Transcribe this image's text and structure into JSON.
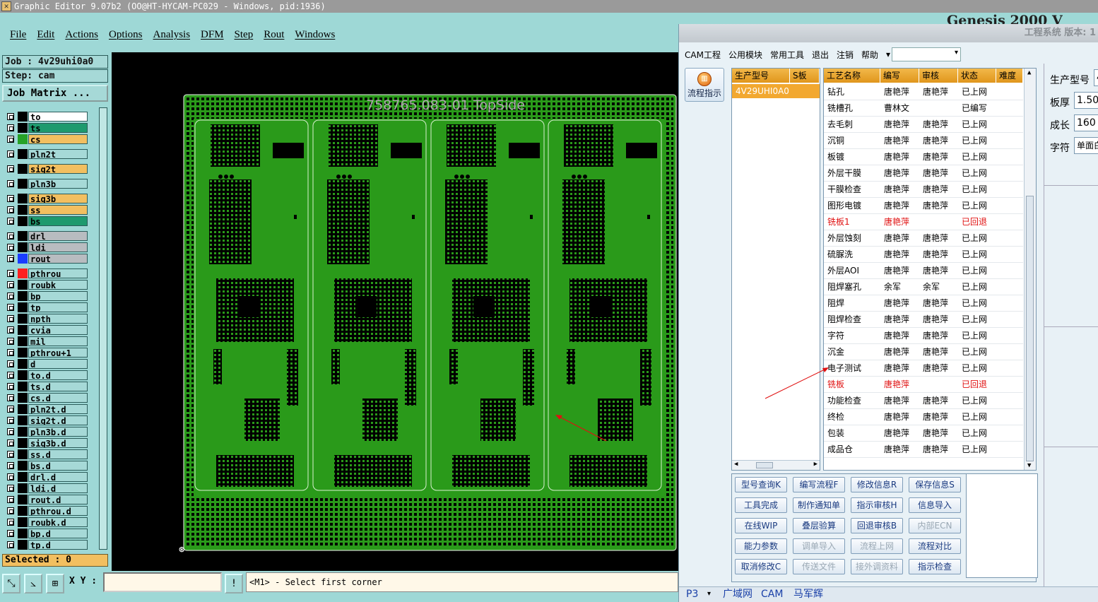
{
  "window_title": "Graphic Editor 9.07b2 (OO@HT-HYCAM-PC029 - Windows, pid:1936)",
  "bg_window_title": "Genesis 2000 V",
  "menu": [
    "File",
    "Edit",
    "Actions",
    "Options",
    "Analysis",
    "DFM",
    "Step",
    "Rout",
    "Windows"
  ],
  "job_label": "Job : 4v29uhi0a0",
  "step_label": "Step: cam",
  "job_matrix_button": "Job Matrix ...",
  "layers": [
    {
      "name": "to",
      "color": "#ffffff",
      "swatch": "#000000"
    },
    {
      "name": "ts",
      "color": "#1e9a6e",
      "swatch": "#000000"
    },
    {
      "name": "cs",
      "color": "#f2bf60",
      "swatch": "#27a227"
    },
    {
      "name": "pln2t",
      "color": "#a6d9d7",
      "swatch": "#000000"
    },
    {
      "name": "sig2t",
      "color": "#f2bf60",
      "swatch": "#000000"
    },
    {
      "name": "pln3b",
      "color": "#a6d9d7",
      "swatch": "#000000"
    },
    {
      "name": "sig3b",
      "color": "#f2bf60",
      "swatch": "#000000"
    },
    {
      "name": "ss",
      "color": "#f2bf60",
      "swatch": "#000000"
    },
    {
      "name": "bs",
      "color": "#1e9a6e",
      "swatch": "#000000"
    },
    {
      "name": "drl",
      "color": "#b8bcc0",
      "swatch": "#000000"
    },
    {
      "name": "ldi",
      "color": "#b8bcc0",
      "swatch": "#000000"
    },
    {
      "name": "rout",
      "color": "#b8bcc0",
      "swatch": "#1a3cff"
    },
    {
      "name": "pthrou",
      "color": "#a6d9d7",
      "swatch": "#ff2020"
    },
    {
      "name": "roubk",
      "color": "#a6d9d7",
      "swatch": "#000000"
    },
    {
      "name": "bp",
      "color": "#a6d9d7",
      "swatch": "#000000"
    },
    {
      "name": "tp",
      "color": "#a6d9d7",
      "swatch": "#000000"
    },
    {
      "name": "npth",
      "color": "#a6d9d7",
      "swatch": "#000000"
    },
    {
      "name": "cvia",
      "color": "#a6d9d7",
      "swatch": "#000000"
    },
    {
      "name": "mil",
      "color": "#a6d9d7",
      "swatch": "#000000"
    },
    {
      "name": "pthrou+1",
      "color": "#a6d9d7",
      "swatch": "#000000"
    },
    {
      "name": "d",
      "color": "#a6d9d7",
      "swatch": "#000000"
    },
    {
      "name": "to.d",
      "color": "#a6d9d7",
      "swatch": "#000000"
    },
    {
      "name": "ts.d",
      "color": "#a6d9d7",
      "swatch": "#000000"
    },
    {
      "name": "cs.d",
      "color": "#a6d9d7",
      "swatch": "#000000"
    },
    {
      "name": "pln2t.d",
      "color": "#a6d9d7",
      "swatch": "#000000"
    },
    {
      "name": "sig2t.d",
      "color": "#a6d9d7",
      "swatch": "#000000"
    },
    {
      "name": "pln3b.d",
      "color": "#a6d9d7",
      "swatch": "#000000"
    },
    {
      "name": "sig3b.d",
      "color": "#a6d9d7",
      "swatch": "#000000"
    },
    {
      "name": "ss.d",
      "color": "#a6d9d7",
      "swatch": "#000000"
    },
    {
      "name": "bs.d",
      "color": "#a6d9d7",
      "swatch": "#000000"
    },
    {
      "name": "drl.d",
      "color": "#a6d9d7",
      "swatch": "#000000"
    },
    {
      "name": "ldi.d",
      "color": "#a6d9d7",
      "swatch": "#000000"
    },
    {
      "name": "rout.d",
      "color": "#a6d9d7",
      "swatch": "#000000"
    },
    {
      "name": "pthrou.d",
      "color": "#a6d9d7",
      "swatch": "#000000"
    },
    {
      "name": "roubk.d",
      "color": "#a6d9d7",
      "swatch": "#000000"
    },
    {
      "name": "bp.d",
      "color": "#a6d9d7",
      "swatch": "#000000"
    },
    {
      "name": "tp.d",
      "color": "#a6d9d7",
      "swatch": "#000000"
    }
  ],
  "selected_label": "Selected : 0",
  "board_title": "758765.083-01 TopSide",
  "board_small_label": "758765.083-01",
  "xy_label": "X Y :",
  "xy_value": "",
  "prompt_text": "<M1> - Select first corner",
  "cam": {
    "title": "工程系统 版本: 1",
    "menu": [
      "CAM工程",
      "公用模块",
      "常用工具",
      "退出",
      "注销",
      "帮助"
    ],
    "flow_button": "流程指示",
    "left_headers": [
      "生产型号",
      "S板"
    ],
    "left_rows": [
      "4V29UHI0A0"
    ],
    "headers": [
      "工艺名称",
      "编写",
      "审核",
      "状态",
      "难度"
    ],
    "rows": [
      {
        "name": "钻孔",
        "author": "唐艳萍",
        "reviewer": "唐艳萍",
        "status": "已上网",
        "red": false
      },
      {
        "name": "铣槽孔",
        "author": "曹林文",
        "reviewer": "",
        "status": "已编写",
        "red": false
      },
      {
        "name": "去毛刺",
        "author": "唐艳萍",
        "reviewer": "唐艳萍",
        "status": "已上网",
        "red": false
      },
      {
        "name": "沉铜",
        "author": "唐艳萍",
        "reviewer": "唐艳萍",
        "status": "已上网",
        "red": false
      },
      {
        "name": "板镀",
        "author": "唐艳萍",
        "reviewer": "唐艳萍",
        "status": "已上网",
        "red": false
      },
      {
        "name": "外层干膜",
        "author": "唐艳萍",
        "reviewer": "唐艳萍",
        "status": "已上网",
        "red": false
      },
      {
        "name": "干膜检查",
        "author": "唐艳萍",
        "reviewer": "唐艳萍",
        "status": "已上网",
        "red": false
      },
      {
        "name": "图形电镀",
        "author": "唐艳萍",
        "reviewer": "唐艳萍",
        "status": "已上网",
        "red": false
      },
      {
        "name": "铣板1",
        "author": "唐艳萍",
        "reviewer": "",
        "status": "已回退",
        "red": true
      },
      {
        "name": "外层蚀刻",
        "author": "唐艳萍",
        "reviewer": "唐艳萍",
        "status": "已上网",
        "red": false
      },
      {
        "name": "硫脲洗",
        "author": "唐艳萍",
        "reviewer": "唐艳萍",
        "status": "已上网",
        "red": false
      },
      {
        "name": "外层AOI",
        "author": "唐艳萍",
        "reviewer": "唐艳萍",
        "status": "已上网",
        "red": false
      },
      {
        "name": "阻焊塞孔",
        "author": "余军",
        "reviewer": "余军",
        "status": "已上网",
        "red": false
      },
      {
        "name": "阻焊",
        "author": "唐艳萍",
        "reviewer": "唐艳萍",
        "status": "已上网",
        "red": false
      },
      {
        "name": "阻焊检查",
        "author": "唐艳萍",
        "reviewer": "唐艳萍",
        "status": "已上网",
        "red": false
      },
      {
        "name": "字符",
        "author": "唐艳萍",
        "reviewer": "唐艳萍",
        "status": "已上网",
        "red": false
      },
      {
        "name": "沉金",
        "author": "唐艳萍",
        "reviewer": "唐艳萍",
        "status": "已上网",
        "red": false
      },
      {
        "name": "电子测试",
        "author": "唐艳萍",
        "reviewer": "唐艳萍",
        "status": "已上网",
        "red": false
      },
      {
        "name": "铣板",
        "author": "唐艳萍",
        "reviewer": "",
        "status": "已回退",
        "red": true
      },
      {
        "name": "功能检查",
        "author": "唐艳萍",
        "reviewer": "唐艳萍",
        "status": "已上网",
        "red": false
      },
      {
        "name": "终检",
        "author": "唐艳萍",
        "reviewer": "唐艳萍",
        "status": "已上网",
        "red": false
      },
      {
        "name": "包装",
        "author": "唐艳萍",
        "reviewer": "唐艳萍",
        "status": "已上网",
        "red": false
      },
      {
        "name": "成品仓",
        "author": "唐艳萍",
        "reviewer": "唐艳萍",
        "status": "已上网",
        "red": false
      }
    ],
    "buttons": [
      [
        "型号查询K",
        "编写流程F",
        "修改信息R",
        "保存信息S"
      ],
      [
        "工具完成",
        "制作通知单",
        "指示审核H",
        "信息导入"
      ],
      [
        "在线WIP",
        "叠层验算",
        "回退审核B",
        "内部ECN"
      ],
      [
        "能力参数",
        "调单导入",
        "流程上网",
        "流程对比"
      ],
      [
        "取消修改C",
        "传送文件",
        "接外调资料",
        "指示检查"
      ]
    ],
    "disabled_buttons": [
      "内部ECN",
      "调单导入",
      "流程上网",
      "传送文件",
      "接外调资料"
    ],
    "right_fields": [
      {
        "label": "生产型号",
        "value": "4"
      },
      {
        "label": "板厚",
        "value": "1.50"
      },
      {
        "label": "成长",
        "value": "160"
      },
      {
        "label": "字符",
        "value": "单面白"
      }
    ],
    "taskbar": [
      "P3",
      "广域网",
      "CAM",
      "马军辉"
    ]
  },
  "colors": {
    "board_green": "#2a9a1a",
    "red_text": "#e01010",
    "accent_orange": "#f2bf60"
  }
}
